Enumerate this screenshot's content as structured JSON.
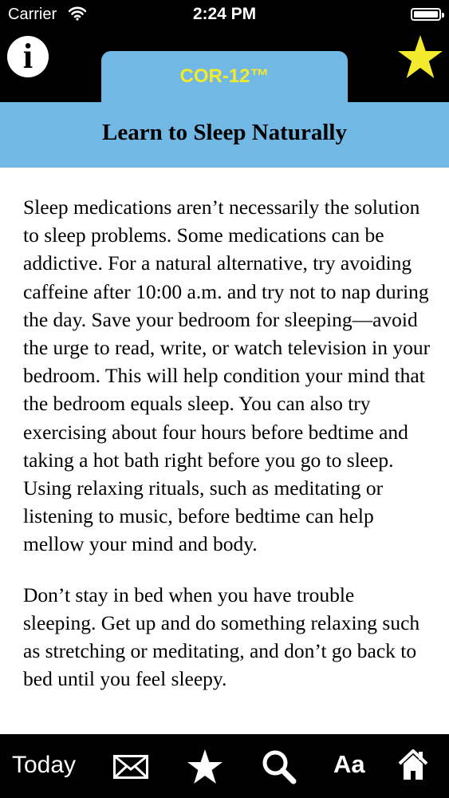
{
  "status_bar": {
    "carrier": "Carrier",
    "time": "2:24 PM"
  },
  "header": {
    "info_glyph": "i",
    "tab_label": "COR-12™",
    "title": "Learn to Sleep Naturally",
    "tab_color": "#72b8e4",
    "tab_label_color": "#f3ea2e",
    "favorite_color": "#f3ea2e"
  },
  "content": {
    "paragraphs": [
      "Sleep medications aren’t necessarily the solution to sleep problems. Some medications can be addictive. For a natural alternative, try avoiding caffeine after 10:00 a.m. and try not to nap during the day. Save your bedroom for sleeping—avoid the urge to read, write, or watch television in your bedroom. This will help condition your mind that the bedroom equals sleep. You can also try exercising about four hours before bedtime and taking a hot bath right before you go to sleep. Using relaxing rituals, such as meditating or listening to music, before bedtime can help mellow your mind and body.",
      "Don’t stay in bed when you have trouble sleeping. Get up and do something relaxing such as stretching or meditating, and don’t go back to bed until you feel sleepy."
    ]
  },
  "toolbar": {
    "today_label": "Today",
    "font_size_label": "Aa",
    "icons": [
      "mail-icon",
      "star-icon",
      "search-icon",
      "home-icon"
    ]
  }
}
